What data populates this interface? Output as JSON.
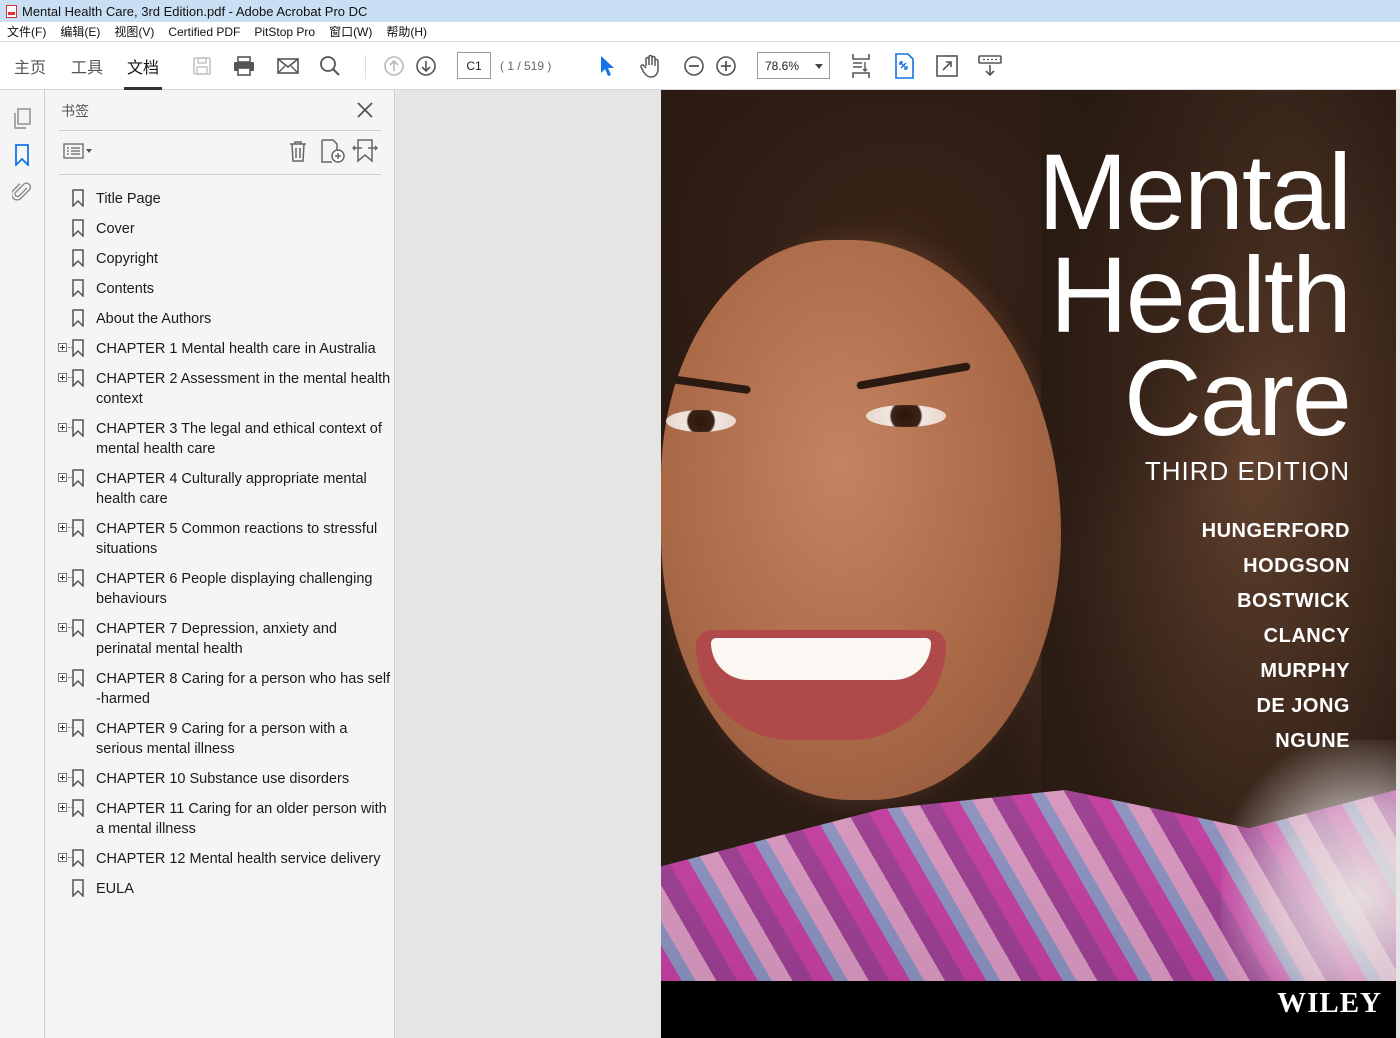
{
  "window": {
    "title": "Mental Health Care, 3rd Edition.pdf - Adobe Acrobat Pro DC"
  },
  "menu": [
    "文件(F)",
    "编辑(E)",
    "视图(V)",
    "Certified PDF",
    "PitStop Pro",
    "窗口(W)",
    "帮助(H)"
  ],
  "toolbar": {
    "tabs": [
      "主页",
      "工具",
      "文档"
    ],
    "active_tab": "文档",
    "page_input": "C1",
    "page_count": "( 1 / 519 )",
    "zoom": "78.6%"
  },
  "panel": {
    "title": "书签",
    "bookmarks": [
      {
        "label": "Title Page",
        "expandable": false
      },
      {
        "label": "Cover",
        "expandable": false
      },
      {
        "label": "Copyright",
        "expandable": false
      },
      {
        "label": "Contents",
        "expandable": false
      },
      {
        "label": "About the Authors",
        "expandable": false
      },
      {
        "label": "CHAPTER 1 Mental health care in Australia",
        "expandable": true
      },
      {
        "label": "CHAPTER 2 Assessment in the mental health context",
        "expandable": true
      },
      {
        "label": "CHAPTER 3 The legal and ethical context of mental health care",
        "expandable": true
      },
      {
        "label": "CHAPTER 4 Culturally appropriate mental health care",
        "expandable": true
      },
      {
        "label": "CHAPTER 5 Common reactions to stressful situations",
        "expandable": true
      },
      {
        "label": "CHAPTER 6 People displaying challenging behaviours",
        "expandable": true
      },
      {
        "label": "CHAPTER 7 Depression, anxiety and perinatal mental health",
        "expandable": true
      },
      {
        "label": "CHAPTER 8 Caring for a person who has self -harmed",
        "expandable": true
      },
      {
        "label": "CHAPTER 9 Caring for a person with a serious mental illness",
        "expandable": true
      },
      {
        "label": "CHAPTER 10 Substance use disorders",
        "expandable": true
      },
      {
        "label": "CHAPTER 11 Caring for an older person with a mental illness",
        "expandable": true
      },
      {
        "label": "CHAPTER 12 Mental health service delivery",
        "expandable": true
      },
      {
        "label": "EULA",
        "expandable": false
      }
    ]
  },
  "cover": {
    "title_lines": [
      "Mental",
      "Health",
      "Care"
    ],
    "edition": "THIRD EDITION",
    "authors": [
      "HUNGERFORD",
      "HODGSON",
      "BOSTWICK",
      "CLANCY",
      "MURPHY",
      "DE JONG",
      "NGUNE"
    ],
    "publisher": "WILEY"
  },
  "colors": {
    "titlebar": "#c9dff3",
    "accent_blue": "#1473e6",
    "icon_gray": "#6b6b6b"
  }
}
